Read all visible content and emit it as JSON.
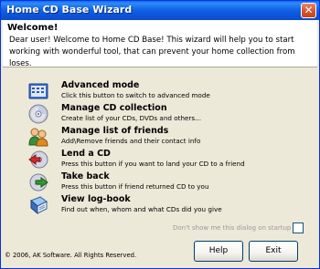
{
  "window": {
    "title": "Home CD Base Wizard",
    "close_glyph": "✕"
  },
  "header": {
    "welcome": "Welcome!",
    "intro": "Dear user! Welcome to Home CD Base! This wizard will help you to start working with wonderful tool, that can prevent your home collection from loses."
  },
  "items": [
    {
      "label": "Advanced mode",
      "desc": "Click this button to switch to advanced mode",
      "icon": "advanced-mode-icon"
    },
    {
      "label": "Manage CD collection",
      "desc": "Create list of your CDs, DVDs and others...",
      "icon": "cd-collection-icon"
    },
    {
      "label": "Manage list of friends",
      "desc": "Add\\Remove friends and their contact info",
      "icon": "friends-icon"
    },
    {
      "label": "Lend a CD",
      "desc": "Press this button if you want to land your CD to a friend",
      "icon": "lend-cd-icon"
    },
    {
      "label": "Take back",
      "desc": "Press this button if friend returned CD to you",
      "icon": "take-back-icon"
    },
    {
      "label": "View log-book",
      "desc": "Find out when, whom and what CDs did you give",
      "icon": "log-book-icon"
    }
  ],
  "footer": {
    "dont_show": "Don't show me this dialog on startup",
    "dont_show_checked": false,
    "copyright": "© 2006, AK Software. All Rights Reserved.",
    "help_label": "Help",
    "exit_label": "Exit"
  }
}
